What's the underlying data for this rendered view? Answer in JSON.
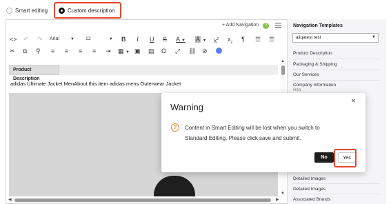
{
  "mode_options": {
    "smart_editing": "Smart editing",
    "custom_description": "Custom description"
  },
  "editor": {
    "add_navigation_label": "+ Add Navigation",
    "help_icon_label": "?",
    "font_family": "Arial",
    "font_size": "12",
    "tab_label": "Product Description",
    "content_title": "adidas Ultimate Jacket MenAbout this item adidas mens Outerwear Jacket"
  },
  "sidebar": {
    "heading": "Navigation Templates",
    "template_select": "aliqatest test",
    "items": [
      "Product Description",
      "Packaging & Shipping",
      "Our Services",
      "Company Information",
      "Rita",
      "Detailed Images",
      "Detailed Images",
      "Associated Brands"
    ]
  },
  "dialog": {
    "title": "Warning",
    "message_line1": "Content in Smart Editing will be lost when you switch to",
    "message_line2": "Standard Editing. Please click save and submit.",
    "no_label": "No",
    "yes_label": "Yes",
    "close_symbol": "×",
    "warning_symbol": "?"
  },
  "colors": {
    "highlight": "#e8452c",
    "warning": "#e08a2a",
    "no_button_bg": "#1e1e1e"
  }
}
